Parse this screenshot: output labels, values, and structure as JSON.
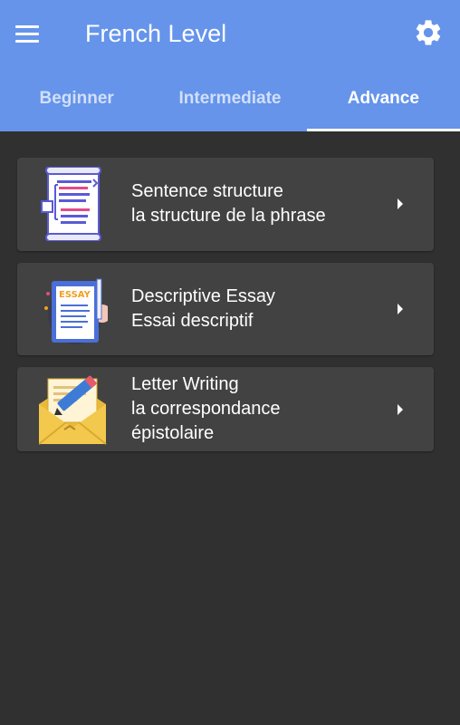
{
  "appbar": {
    "title": "French Level",
    "menu_icon": "hamburger-menu-icon",
    "settings_icon": "gear-icon",
    "color": "#6594ea"
  },
  "tabs": [
    {
      "label": "Beginner",
      "active": false
    },
    {
      "label": "Intermediate",
      "active": false
    },
    {
      "label": "Advance",
      "active": true
    }
  ],
  "lessons": [
    {
      "title": "Sentence structure",
      "subtitle": "la structure de la phrase",
      "icon": "document-scroll-icon"
    },
    {
      "title": "Descriptive Essay",
      "subtitle": "Essai descriptif",
      "icon": "essay-clipboard-icon",
      "icon_text": "ESSAY"
    },
    {
      "title": "Letter Writing",
      "subtitle_line1": "la correspondance",
      "subtitle_line2": "épistolaire",
      "icon": "letter-envelope-icon"
    }
  ]
}
